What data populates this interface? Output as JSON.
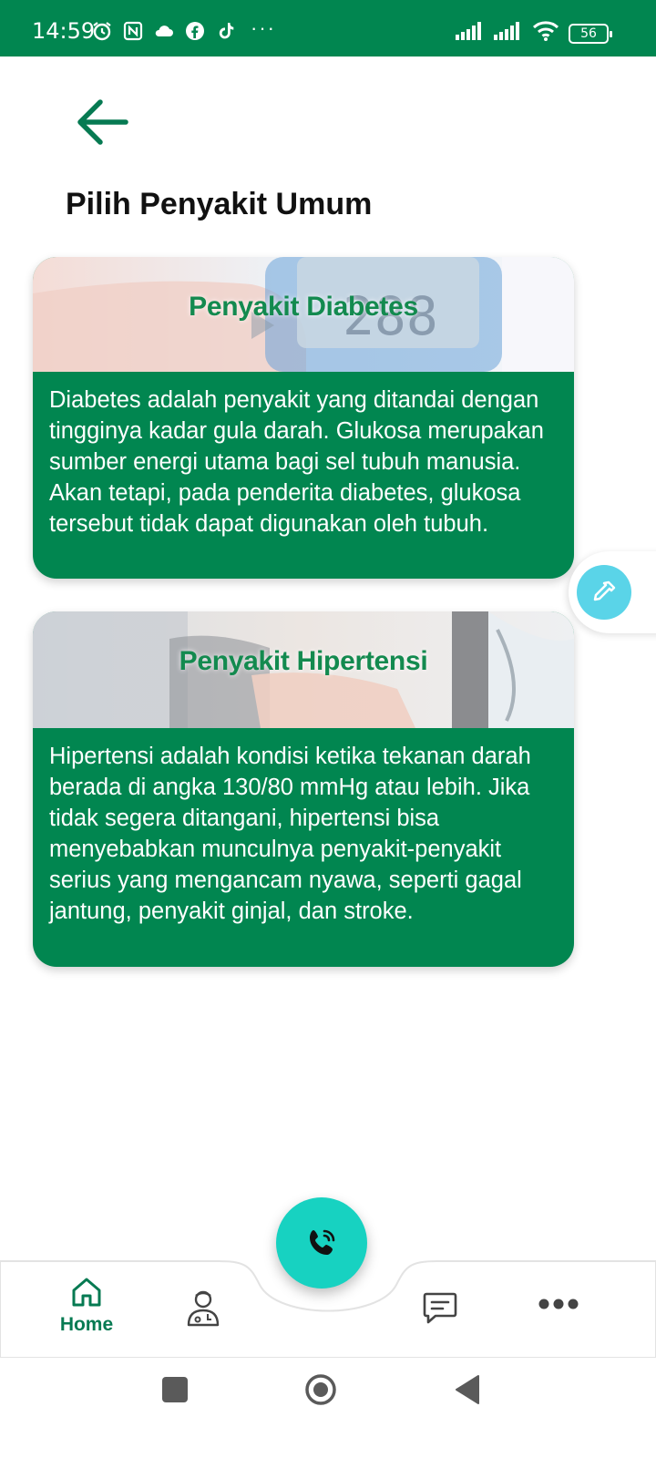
{
  "status_bar": {
    "time": "14:59",
    "battery": "56",
    "more": "···"
  },
  "header": {
    "back_icon": "arrow-left-icon",
    "title": "Pilih Penyakit Umum"
  },
  "cards": [
    {
      "banner_title": "Penyakit Diabetes",
      "description": "Diabetes adalah penyakit yang ditandai dengan tingginya kadar gula darah. Glukosa merupakan sumber energi utama bagi sel tubuh manusia. Akan tetapi, pada penderita diabetes, glukosa tersebut tidak dapat digunakan oleh tubuh."
    },
    {
      "banner_title": "Penyakit Hipertensi",
      "description": "Hipertensi adalah kondisi ketika tekanan darah berada di angka 130/80 mmHg atau lebih. Jika tidak segera ditangani, hipertensi bisa menyebabkan munculnya penyakit-penyakit serius yang mengancam nyawa, seperti gagal jantung, penyakit ginjal, dan stroke."
    }
  ],
  "bottom_nav": {
    "home_label": "Home",
    "items": [
      "home-icon",
      "doctor-icon",
      "phone-call-icon",
      "chat-icon",
      "more-icon"
    ]
  },
  "colors": {
    "primary": "#018650",
    "accent": "#17d2c1",
    "float_button": "#5ad4e8"
  }
}
